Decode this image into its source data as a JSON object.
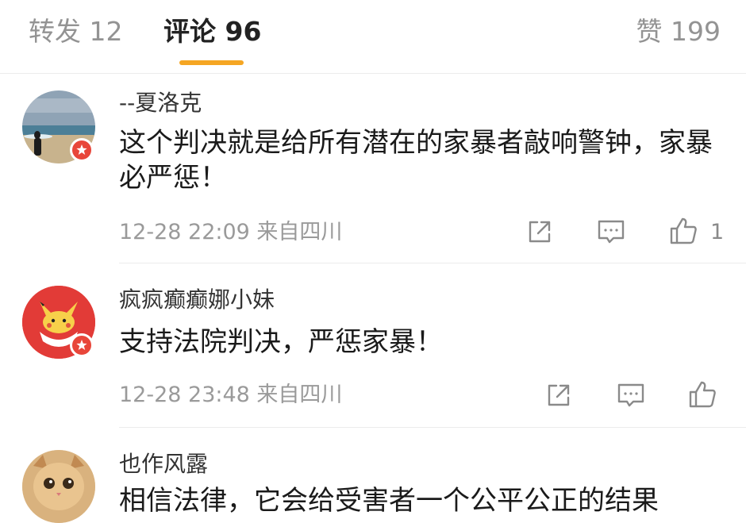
{
  "tabs": {
    "repost": "转发 12",
    "comments": "评论 96",
    "likes": "赞 199",
    "accent_color": "#f5a623"
  },
  "comments": [
    {
      "username": "--夏洛克",
      "text": "这个判决就是给所有潜在的家暴者敲响警钟，家暴必严惩！",
      "meta": "12-28 22:09 来自四川",
      "like_count": "1"
    },
    {
      "username": "疯疯癫癫娜小妹",
      "text": "支持法院判决，严惩家暴！",
      "meta": "12-28 23:48 来自四川",
      "like_count": ""
    },
    {
      "username": "也作风露",
      "text": "相信法律，它会给受害者一个公平公正的结果",
      "meta": "",
      "like_count": ""
    }
  ],
  "icons": {
    "share": "share-icon",
    "reply": "comment-icon",
    "like": "thumbs-up-icon",
    "verified": "verified-badge-icon"
  },
  "badge_color": "#e8463a"
}
